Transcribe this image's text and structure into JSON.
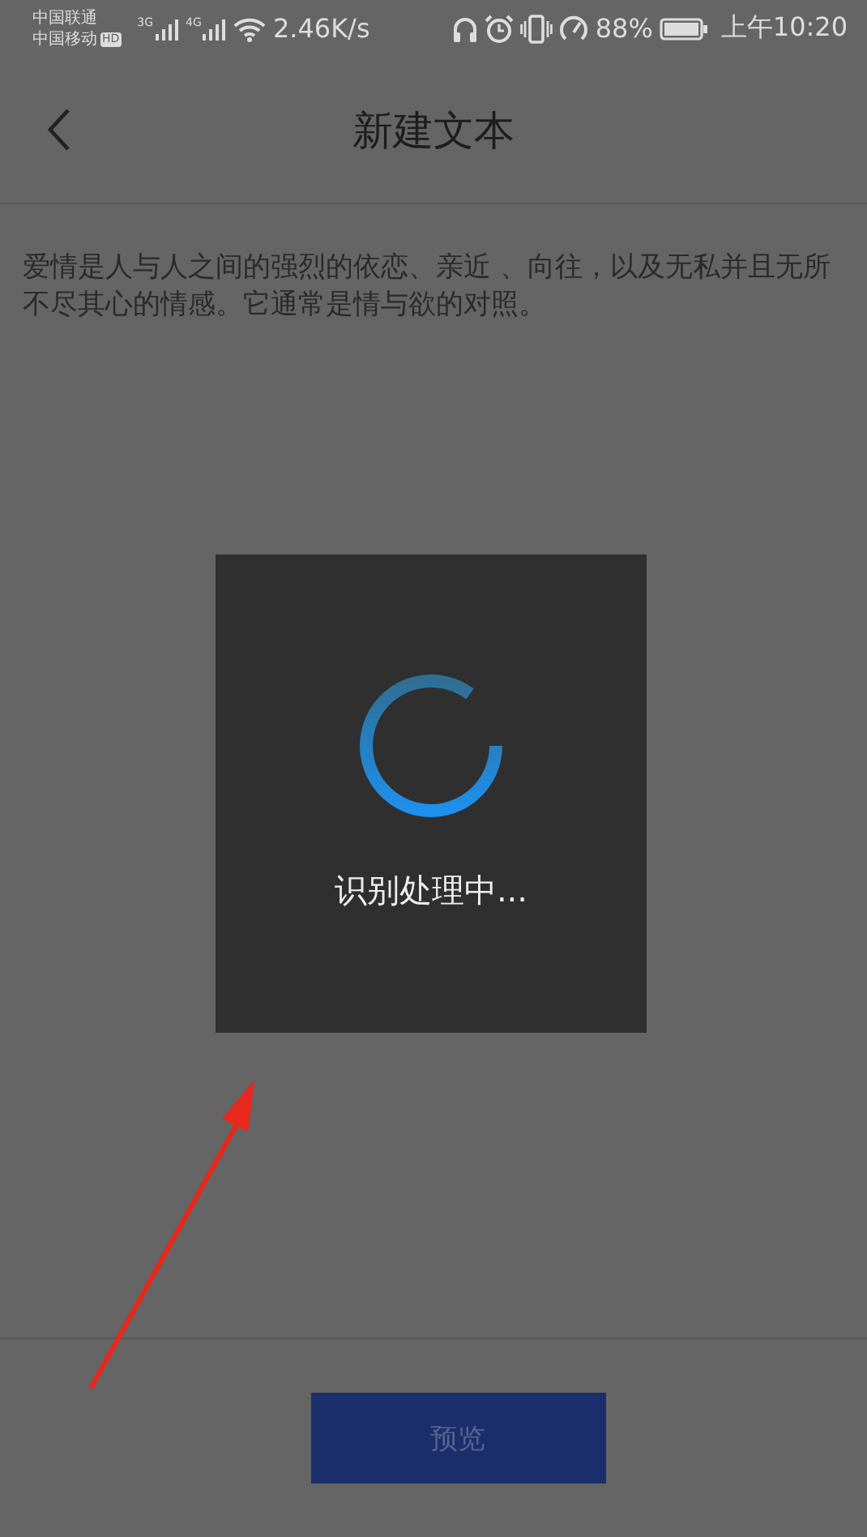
{
  "status_bar": {
    "carriers": [
      "中国联通",
      "中国移动"
    ],
    "hd_badge": "HD",
    "networks": [
      "3G",
      "4G"
    ],
    "speed": "2.46K/s",
    "battery": "88%",
    "time": "上午10:20"
  },
  "header": {
    "title": "新建文本"
  },
  "body_text": "爱情是人与人之间的强烈的依恋、亲近 、向往，以及无私并且无所不尽其心的情感。它通常是情与欲的对照。",
  "dialog": {
    "message": "识别处理中..."
  },
  "button": {
    "label": "预览"
  }
}
